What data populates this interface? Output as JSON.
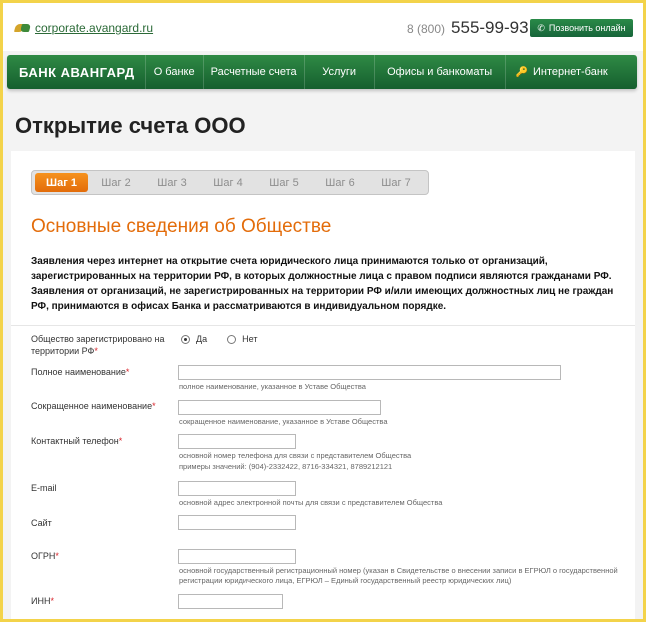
{
  "header": {
    "site_link": "corporate.avangard.ru",
    "phone_code": "8 (800)",
    "phone_number": "555-99-93",
    "call_button": "Позвонить онлайн"
  },
  "nav": {
    "brand": "БАНК АВАНГАРД",
    "items": [
      "О банке",
      "Расчетные счета",
      "Услуги",
      "Офисы и банкоматы",
      "Интернет-банк"
    ]
  },
  "page": {
    "title": "Открытие счета ООО",
    "steps": [
      "Шаг 1",
      "Шаг 2",
      "Шаг 3",
      "Шаг 4",
      "Шаг 5",
      "Шаг 6",
      "Шаг 7"
    ],
    "active_step": "Шаг 1",
    "section_title": "Основные сведения об Обществе",
    "notice": "Заявления через интернет на открытие счета юридического лица принимаются только от организаций, зарегистрированных на территории РФ, в которых должностные лица с правом подписи являются гражданами РФ. Заявления от организаций, не зарегистрированных на территории РФ и/или имеющих должностных лиц не граждан РФ, принимаются в офисах Банка и рассматриваются в индивидуальном порядке."
  },
  "form": {
    "registered_rf": {
      "label_line1": "Общество зарегистрировано на",
      "label_line2": "территории РФ",
      "option_yes": "Да",
      "option_no": "Нет",
      "selected": "Да"
    },
    "full_name": {
      "label": "Полное наименование",
      "value": "",
      "hint": "полное наименование, указанное в Уставе Общества"
    },
    "short_name": {
      "label": "Сокращенное наименование",
      "value": "",
      "hint": "сокращенное наименование, указанное в Уставе Общества"
    },
    "phone": {
      "label": "Контактный телефон",
      "value": "",
      "hint_line1": "основной номер телефона для связи с представителем Общества",
      "hint_line2": "примеры значений: (904)-2332422, 8716-334321, 8789212121"
    },
    "email": {
      "label": "E-mail",
      "value": "",
      "hint": "основной адрес электронной почты для связи с представителем Общества"
    },
    "site": {
      "label": "Сайт",
      "value": ""
    },
    "ogrn": {
      "label": "ОГРН",
      "value": "",
      "hint_line1": "основной государственный регистрационный номер (указан в Свидетельстве о внесении записи в ЕГРЮЛ о государственной",
      "hint_line2": "регистрации юридического лица, ЕГРЮЛ – Единый государственный реестр юридических лиц)"
    },
    "inn": {
      "label": "ИНН",
      "value": ""
    },
    "required_mark": "*"
  }
}
